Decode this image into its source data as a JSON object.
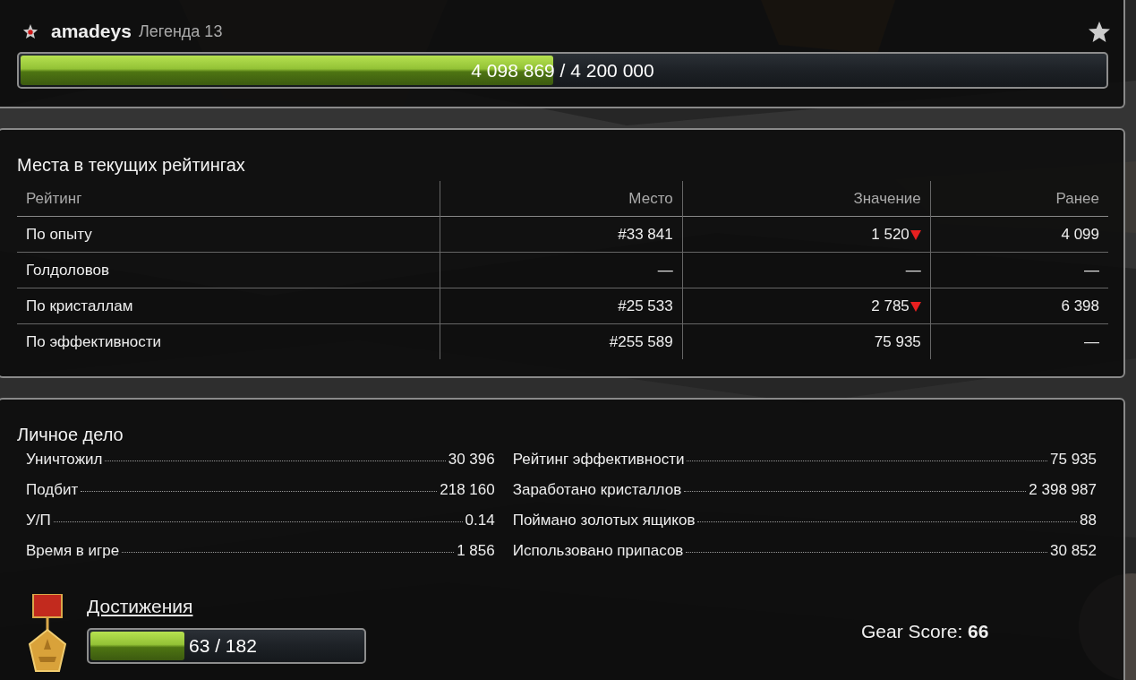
{
  "header": {
    "name": "amadeys",
    "rank": "Легенда 13",
    "progress": {
      "level": 0.49,
      "text": "4 098 869 / 4 200 000"
    }
  },
  "ratings": {
    "title": "Места в текущих рейтингах",
    "columns": [
      "Рейтинг",
      "Место",
      "Значение",
      "Ранее"
    ],
    "rows": [
      {
        "label": "По опыту",
        "place": "#33 841",
        "value": "1 520",
        "down": true,
        "previous": "4 099"
      },
      {
        "label": "Голдоловов",
        "place": "—",
        "value": "—",
        "down": false,
        "previous": "—"
      },
      {
        "label": "По кристаллам",
        "place": "#25 533",
        "value": "2 785",
        "down": true,
        "previous": "6 398"
      },
      {
        "label": "По эффективности",
        "place": "#255 589",
        "value": "75 935",
        "down": false,
        "previous": "—"
      }
    ]
  },
  "personal": {
    "title": "Личное дело",
    "left": [
      {
        "label": "Уничтожил",
        "value": "30 396"
      },
      {
        "label": "Подбит",
        "value": "218 160"
      },
      {
        "label": "У/П",
        "value": "0.14"
      },
      {
        "label": "Время в игре",
        "value": "1 856"
      }
    ],
    "right": [
      {
        "label": "Рейтинг эффективности",
        "value": "75 935"
      },
      {
        "label": "Заработано кристаллов",
        "value": "2 398 987"
      },
      {
        "label": "Поймано золотых ящиков",
        "value": "88"
      },
      {
        "label": "Использовано припасов",
        "value": "30 852"
      }
    ],
    "achievements": {
      "title": "Достижения",
      "progress": {
        "level": 0.34,
        "text": "63 / 182"
      }
    },
    "gear_score": {
      "label": "Gear Score:",
      "value": "66"
    }
  }
}
